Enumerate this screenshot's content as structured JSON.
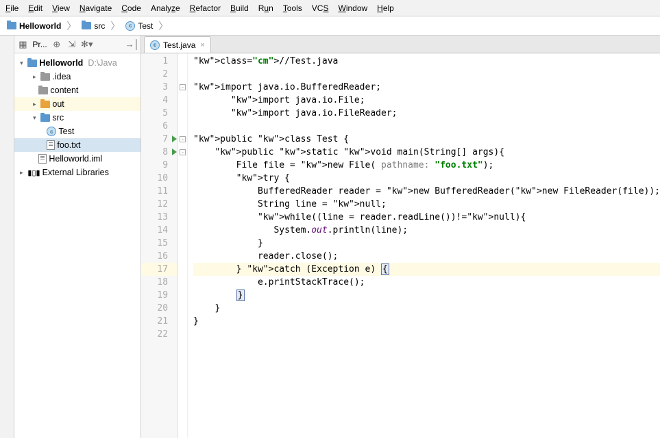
{
  "menu": {
    "file": "File",
    "edit": "Edit",
    "view": "View",
    "navigate": "Navigate",
    "code": "Code",
    "analyze": "Analyze",
    "refactor": "Refactor",
    "build": "Build",
    "run": "Run",
    "tools": "Tools",
    "vcs": "VCS",
    "window": "Window",
    "help": "Help"
  },
  "breadcrumb": {
    "project": "Helloworld",
    "src": "src",
    "file": "Test"
  },
  "sidebar": {
    "title": "Pr..."
  },
  "tree": {
    "root": {
      "name": "Helloworld",
      "path": "D:\\Java"
    },
    "idea": ".idea",
    "content": "content",
    "out": "out",
    "src": "src",
    "test": "Test",
    "foo": "foo.txt",
    "iml": "Helloworld.iml",
    "ext": "External Libraries"
  },
  "tab": {
    "name": "Test.java"
  },
  "code": {
    "lines": [
      "//Test.java",
      "",
      "import java.io.BufferedReader;",
      "       import java.io.File;",
      "       import java.io.FileReader;",
      "",
      "public class Test {",
      "    public static void main(String[] args){",
      "        File file = new File( pathname: \"foo.txt\");",
      "        try {",
      "            BufferedReader reader = new BufferedReader(new FileReader(file));",
      "            String line = null;",
      "            while((line = reader.readLine())!=null){",
      "               System.out.println(line);",
      "            }",
      "            reader.close();",
      "        } catch (Exception e) {",
      "            e.printStackTrace();",
      "        }",
      "    }",
      "}",
      ""
    ]
  }
}
